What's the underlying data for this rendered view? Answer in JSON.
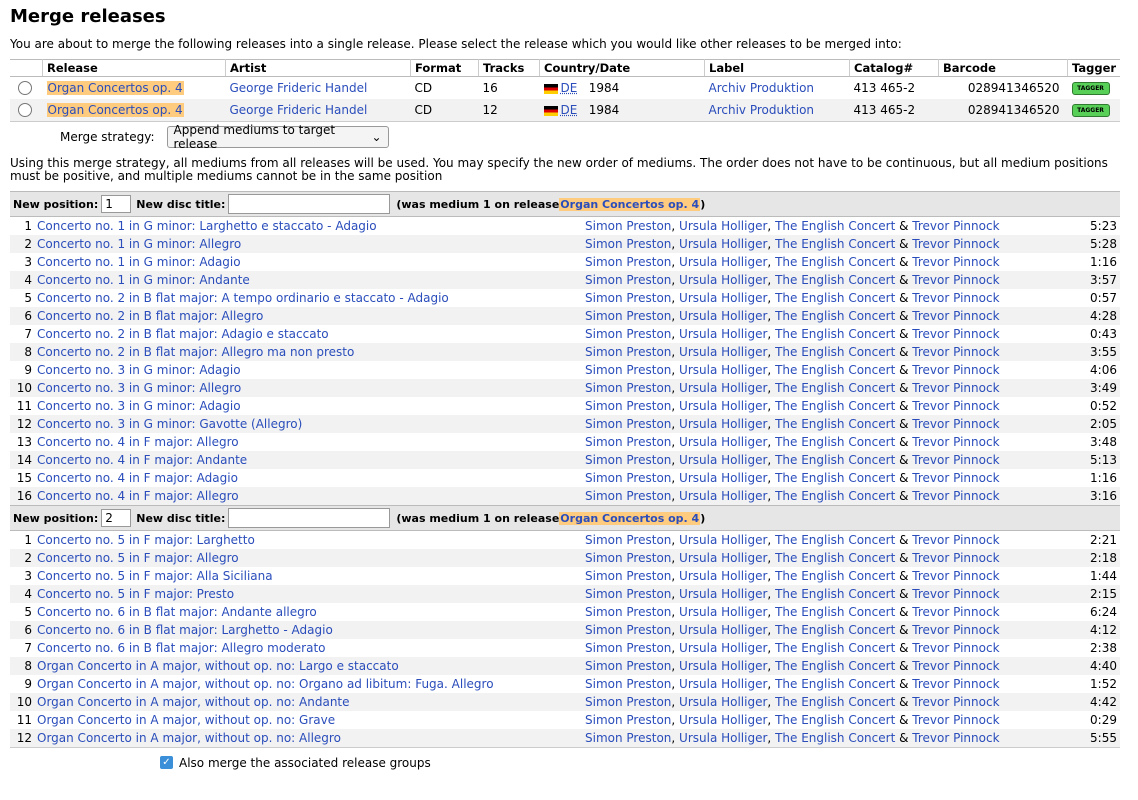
{
  "page": {
    "title": "Merge releases",
    "intro": "You are about to merge the following releases into a single release. Please select the release which you would like other releases to be merged into:"
  },
  "release_table": {
    "headers": [
      "Release",
      "Artist",
      "Format",
      "Tracks",
      "Country/Date",
      "Label",
      "Catalog#",
      "Barcode",
      "Tagger"
    ],
    "rows": [
      {
        "release": "Organ Concertos op. 4",
        "artist": "George Frideric Handel",
        "format": "CD",
        "tracks": "16",
        "country": "DE",
        "date": "1984",
        "label": "Archiv Produktion",
        "catalog": "413 465-2",
        "barcode": "028941346520",
        "tagger": "TAGGER"
      },
      {
        "release": "Organ Concertos op. 4",
        "artist": "George Frideric Handel",
        "format": "CD",
        "tracks": "12",
        "country": "DE",
        "date": "1984",
        "label": "Archiv Produktion",
        "catalog": "413 465-2",
        "barcode": "028941346520",
        "tagger": "TAGGER"
      }
    ]
  },
  "strategy": {
    "label": "Merge strategy:",
    "selected": "Append mediums to target release",
    "explanation": "Using this merge strategy, all mediums from all releases will be used. You may specify the new order of mediums. The order does not have to be continuous, but all medium positions must be positive, and multiple mediums cannot be in the same position"
  },
  "medium_labels": {
    "new_position": "New position:",
    "new_disc_title": "New disc title:",
    "was_prefix": "(was medium 1 on release ",
    "was_suffix": ")"
  },
  "mediums": [
    {
      "position": "1",
      "was_release": "Organ Concertos op. 4",
      "tracks": [
        {
          "n": "1",
          "title": "Concerto no. 1 in G minor: Larghetto e staccato - Adagio",
          "length": "5:23"
        },
        {
          "n": "2",
          "title": "Concerto no. 1 in G minor: Allegro",
          "length": "5:28"
        },
        {
          "n": "3",
          "title": "Concerto no. 1 in G minor: Adagio",
          "length": "1:16"
        },
        {
          "n": "4",
          "title": "Concerto no. 1 in G minor: Andante",
          "length": "3:57"
        },
        {
          "n": "5",
          "title": "Concerto no. 2 in B flat major: A tempo ordinario e staccato - Adagio",
          "length": "0:57"
        },
        {
          "n": "6",
          "title": "Concerto no. 2 in B flat major: Allegro",
          "length": "4:28"
        },
        {
          "n": "7",
          "title": "Concerto no. 2 in B flat major: Adagio e staccato",
          "length": "0:43"
        },
        {
          "n": "8",
          "title": "Concerto no. 2 in B flat major: Allegro ma non presto",
          "length": "3:55"
        },
        {
          "n": "9",
          "title": "Concerto no. 3 in G minor: Adagio",
          "length": "4:06"
        },
        {
          "n": "10",
          "title": "Concerto no. 3 in G minor: Allegro",
          "length": "3:49"
        },
        {
          "n": "11",
          "title": "Concerto no. 3 in G minor: Adagio",
          "length": "0:52"
        },
        {
          "n": "12",
          "title": "Concerto no. 3 in G minor: Gavotte (Allegro)",
          "length": "2:05"
        },
        {
          "n": "13",
          "title": "Concerto no. 4 in F major: Allegro",
          "length": "3:48"
        },
        {
          "n": "14",
          "title": "Concerto no. 4 in F major: Andante",
          "length": "5:13"
        },
        {
          "n": "15",
          "title": "Concerto no. 4 in F major: Adagio",
          "length": "1:16"
        },
        {
          "n": "16",
          "title": "Concerto no. 4 in F major: Allegro",
          "length": "3:16"
        }
      ]
    },
    {
      "position": "2",
      "was_release": "Organ Concertos op. 4",
      "tracks": [
        {
          "n": "1",
          "title": "Concerto no. 5 in F major: Larghetto",
          "length": "2:21"
        },
        {
          "n": "2",
          "title": "Concerto no. 5 in F major: Allegro",
          "length": "2:18"
        },
        {
          "n": "3",
          "title": "Concerto no. 5 in F major: Alla Siciliana",
          "length": "1:44"
        },
        {
          "n": "4",
          "title": "Concerto no. 5 in F major: Presto",
          "length": "2:15"
        },
        {
          "n": "5",
          "title": "Concerto no. 6 in B flat major: Andante allegro",
          "length": "6:24"
        },
        {
          "n": "6",
          "title": "Concerto no. 6 in B flat major: Larghetto - Adagio",
          "length": "4:12"
        },
        {
          "n": "7",
          "title": "Concerto no. 6 in B flat major: Allegro moderato",
          "length": "2:38"
        },
        {
          "n": "8",
          "title": "Organ Concerto in A major, without op. no: Largo e staccato",
          "length": "4:40"
        },
        {
          "n": "9",
          "title": "Organ Concerto in A major, without op. no: Organo ad libitum: Fuga. Allegro",
          "length": "1:52"
        },
        {
          "n": "10",
          "title": "Organ Concerto in A major, without op. no: Andante",
          "length": "4:42"
        },
        {
          "n": "11",
          "title": "Organ Concerto in A major, without op. no: Grave",
          "length": "0:29"
        },
        {
          "n": "12",
          "title": "Organ Concerto in A major, without op. no: Allegro",
          "length": "5:55"
        }
      ]
    }
  ],
  "track_artists": [
    "Simon Preston",
    "Ursula Holliger",
    "The English Concert",
    "Trevor Pinnock"
  ],
  "track_artist_separators": [
    ", ",
    ", ",
    " & "
  ],
  "footer": {
    "checkbox_label": "Also merge the associated release groups",
    "checked": true
  }
}
